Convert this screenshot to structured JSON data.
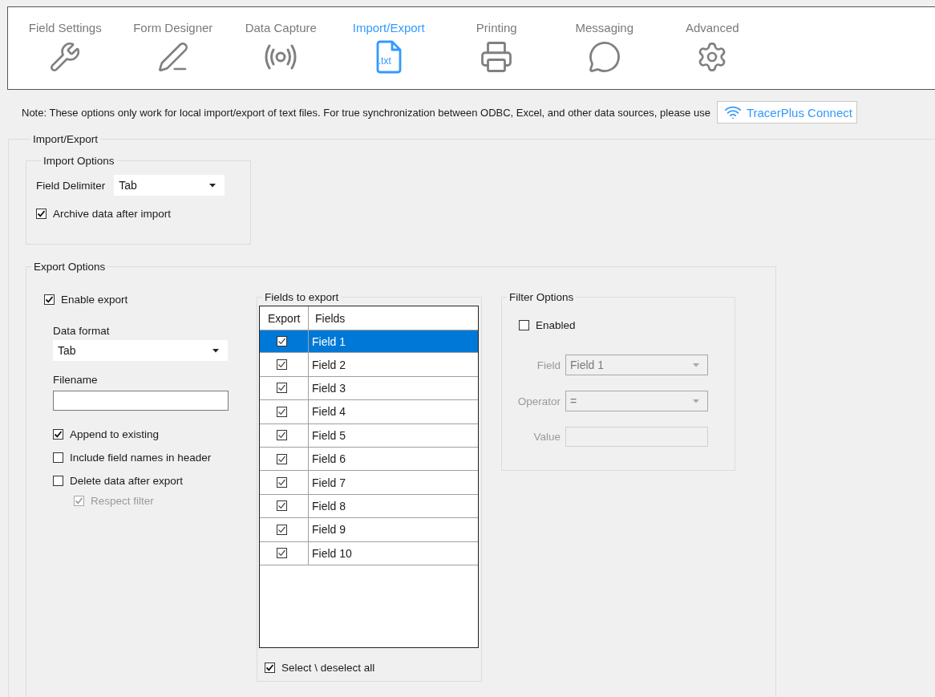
{
  "tabs": [
    {
      "label": "Field Settings",
      "kind": "wrench",
      "selected": false
    },
    {
      "label": "Form Designer",
      "kind": "pencil",
      "selected": false
    },
    {
      "label": "Data Capture",
      "kind": "signal",
      "selected": false
    },
    {
      "label": "Import/Export",
      "kind": "file",
      "icon_label": ".txt",
      "selected": true
    },
    {
      "label": "Printing",
      "kind": "printer",
      "selected": false
    },
    {
      "label": "Messaging",
      "kind": "speech",
      "selected": false
    },
    {
      "label": "Advanced",
      "kind": "gear",
      "selected": false
    }
  ],
  "note": {
    "text": "Note: These options only work for local import/export of text files. For true synchronization between ODBC, Excel, and other data sources, please use",
    "button": "TracerPlus Connect"
  },
  "import_export": {
    "title": "Import/Export",
    "import_options": {
      "title": "Import Options",
      "field_delimiter": {
        "label": "Field Delimiter",
        "value": "Tab"
      },
      "archive": {
        "label": "Archive data after import",
        "checked": true
      }
    },
    "export_options": {
      "title": "Export Options",
      "enable_export": {
        "label": "Enable export",
        "checked": true
      },
      "data_format": {
        "label": "Data format",
        "value": "Tab"
      },
      "filename": {
        "label": "Filename"
      },
      "options": [
        {
          "label": "Append to existing",
          "checked": true,
          "disabled": false
        },
        {
          "label": "Include field names in header",
          "checked": false,
          "disabled": false
        },
        {
          "label": "Delete data after export",
          "checked": false,
          "disabled": false,
          "children": [
            {
              "label": "Respect filter",
              "checked": true,
              "disabled": true
            }
          ]
        }
      ],
      "fields_to_export": {
        "title": "Fields to export",
        "columns": [
          "Export",
          "Fields"
        ],
        "rows": [
          {
            "field": "Field 1",
            "checked": true,
            "selected": true
          },
          {
            "field": "Field 2",
            "checked": true,
            "selected": false
          },
          {
            "field": "Field 3",
            "checked": true,
            "selected": false
          },
          {
            "field": "Field 4",
            "checked": true,
            "selected": false
          },
          {
            "field": "Field 5",
            "checked": true,
            "selected": false
          },
          {
            "field": "Field 6",
            "checked": true,
            "selected": false
          },
          {
            "field": "Field 7",
            "checked": true,
            "selected": false
          },
          {
            "field": "Field 8",
            "checked": true,
            "selected": false
          },
          {
            "field": "Field 9",
            "checked": true,
            "selected": false
          },
          {
            "field": "Field 10",
            "checked": true,
            "selected": false
          }
        ],
        "select_all": {
          "label": "Select \\ deselect all",
          "checked": true
        }
      },
      "filter_options": {
        "title": "Filter Options",
        "enabled": {
          "label": "Enabled",
          "checked": false
        },
        "field": {
          "label": "Field",
          "value": "Field 1",
          "disabled": true
        },
        "operator": {
          "label": "Operator",
          "value": "=",
          "disabled": true
        },
        "value": {
          "label": "Value",
          "disabled": true
        }
      }
    }
  }
}
